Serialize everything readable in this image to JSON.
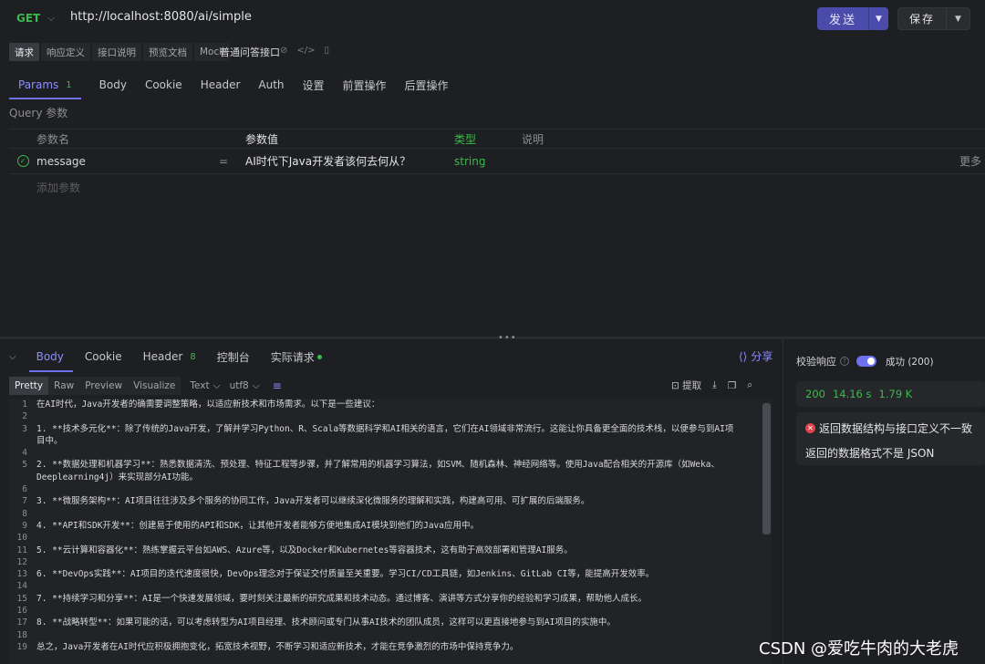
{
  "request": {
    "method": "GET",
    "url": "http://localhost:8080/ai/simple",
    "send_label": "发送",
    "save_label": "保存"
  },
  "doc_tabs": [
    "请求",
    "响应定义",
    "接口说明",
    "预览文档",
    "Mock"
  ],
  "api_name": "普通问答接口",
  "request_tabs": [
    {
      "label": "Params",
      "badge": "1"
    },
    {
      "label": "Body"
    },
    {
      "label": "Cookie"
    },
    {
      "label": "Header"
    },
    {
      "label": "Auth"
    },
    {
      "label": "设置"
    },
    {
      "label": "前置操作"
    },
    {
      "label": "后置操作"
    }
  ],
  "query": {
    "title": "Query 参数",
    "headers": {
      "name": "参数名",
      "value": "参数值",
      "type": "类型",
      "desc": "说明"
    },
    "rows": [
      {
        "name": "message",
        "eq": "=",
        "value": "AI时代下Java开发者该何去何从？",
        "type": "string",
        "more": "更多"
      }
    ],
    "add_placeholder": "添加参数"
  },
  "response": {
    "tabs": [
      {
        "label": "Body"
      },
      {
        "label": "Cookie"
      },
      {
        "label": "Header",
        "badge": "8"
      },
      {
        "label": "控制台"
      },
      {
        "label": "实际请求"
      }
    ],
    "share_label": "分享",
    "formats": [
      "Pretty",
      "Raw",
      "Preview",
      "Visualize"
    ],
    "format_select": "Text",
    "encoding_select": "utf8",
    "extract_label": "提取",
    "lines": [
      {
        "n": "1",
        "t": "在AI时代，Java开发者的确需要调整策略，以适应新技术和市场需求。以下是一些建议："
      },
      {
        "n": "2",
        "t": ""
      },
      {
        "n": "3",
        "t": "1. **技术多元化**：除了传统的Java开发，了解并学习Python、R、Scala等数据科学和AI相关的语言，它们在AI领域非常流行。这能让你具备更全面的技术栈，以便参与到AI项"
      },
      {
        "n": "",
        "t": "目中。"
      },
      {
        "n": "4",
        "t": ""
      },
      {
        "n": "5",
        "t": "2. **数据处理和机器学习**：熟悉数据清洗、预处理、特征工程等步骤，并了解常用的机器学习算法，如SVM、随机森林、神经网络等。使用Java配合相关的开源库（如Weka、"
      },
      {
        "n": "",
        "t": "Deeplearning4j）来实现部分AI功能。"
      },
      {
        "n": "6",
        "t": ""
      },
      {
        "n": "7",
        "t": "3. **微服务架构**：AI项目往往涉及多个服务的协同工作，Java开发者可以继续深化微服务的理解和实践，构建高可用、可扩展的后端服务。"
      },
      {
        "n": "8",
        "t": ""
      },
      {
        "n": "9",
        "t": "4. **API和SDK开发**：创建易于使用的API和SDK，让其他开发者能够方便地集成AI模块到他们的Java应用中。"
      },
      {
        "n": "10",
        "t": ""
      },
      {
        "n": "11",
        "t": "5. **云计算和容器化**：熟练掌握云平台如AWS、Azure等，以及Docker和Kubernetes等容器技术，这有助于高效部署和管理AI服务。"
      },
      {
        "n": "12",
        "t": ""
      },
      {
        "n": "13",
        "t": "6. **DevOps实践**：AI项目的迭代速度很快，DevOps理念对于保证交付质量至关重要。学习CI/CD工具链，如Jenkins、GitLab CI等，能提高开发效率。"
      },
      {
        "n": "14",
        "t": ""
      },
      {
        "n": "15",
        "t": "7. **持续学习和分享**：AI是一个快速发展领域，要时刻关注最新的研究成果和技术动态。通过博客、演讲等方式分享你的经验和学习成果，帮助他人成长。"
      },
      {
        "n": "16",
        "t": ""
      },
      {
        "n": "17",
        "t": "8. **战略转型**：如果可能的话，可以考虑转型为AI项目经理、技术顾问或专门从事AI技术的团队成员，这样可以更直接地参与到AI项目的实施中。"
      },
      {
        "n": "18",
        "t": ""
      },
      {
        "n": "19",
        "t": "总之，Java开发者在AI时代应积极拥抱变化，拓宽技术视野，不断学习和适应新技术，才能在竞争激烈的市场中保持竞争力。"
      }
    ]
  },
  "validation": {
    "label": "校验响应",
    "status_select": "成功 (200)",
    "status_code": "200",
    "time": "14.16 s",
    "size": "1.79 K",
    "error_title": "返回数据结构与接口定义不一致",
    "error_detail": "返回的数据格式不是 JSON"
  },
  "watermark": "CSDN @爱吃牛肉的大老虎",
  "colors": {
    "accent": "#6e70ee",
    "success": "#3cb94c",
    "error": "#e0444b",
    "background": "#1e1f22"
  }
}
